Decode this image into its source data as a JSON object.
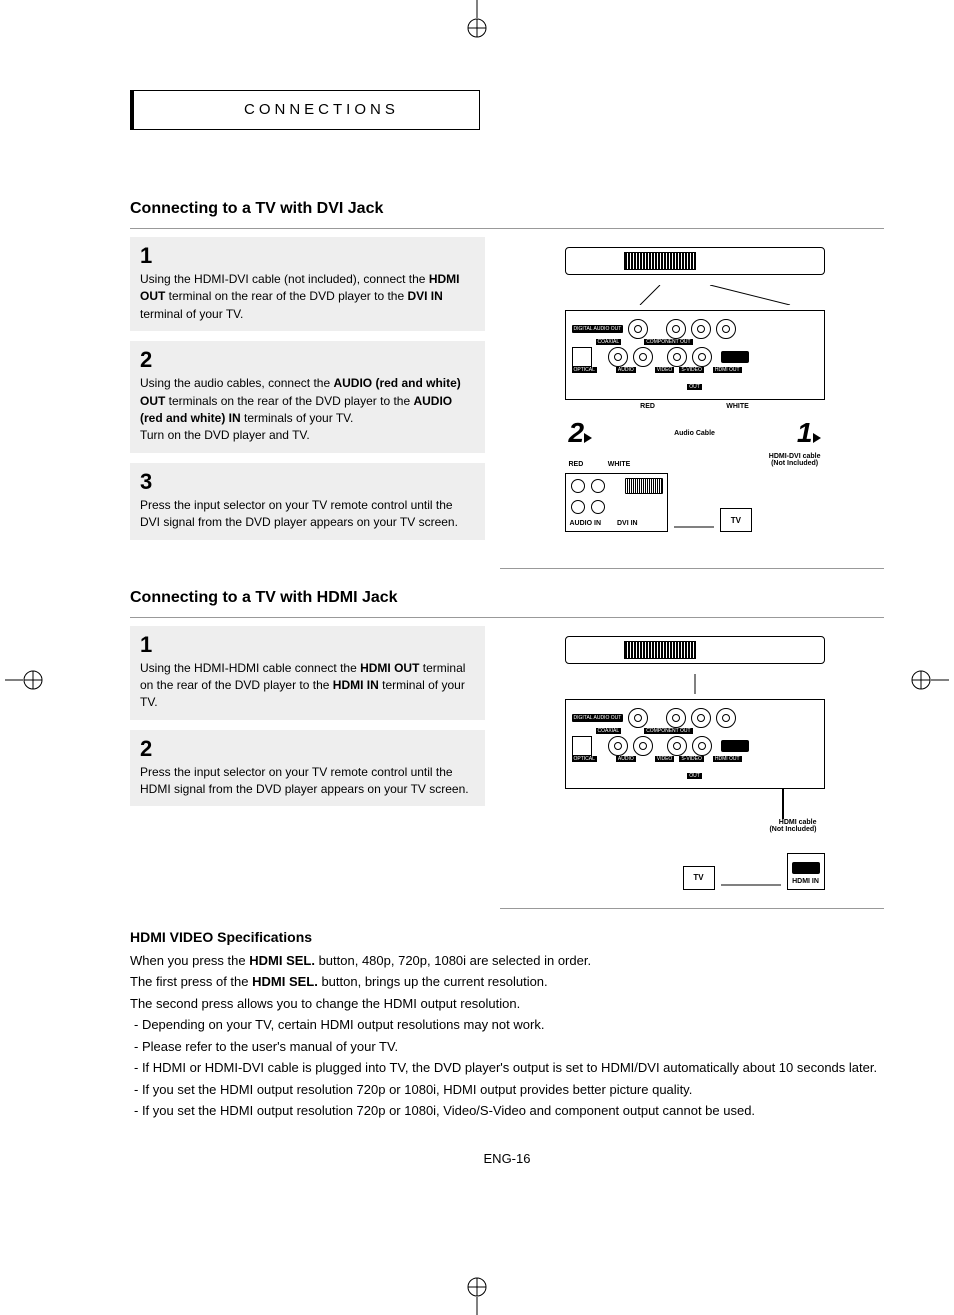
{
  "section_tab": "CONNECTIONS",
  "dvi": {
    "heading": "Connecting to a TV with DVI Jack",
    "steps": [
      {
        "num": "1",
        "parts": [
          {
            "t": "Using the HDMI-DVI cable (not included), connect the ",
            "b": false
          },
          {
            "t": "HDMI OUT",
            "b": true
          },
          {
            "t": " terminal on the rear of the DVD player to the ",
            "b": false
          },
          {
            "t": "DVI IN",
            "b": true
          },
          {
            "t": " terminal of your TV.",
            "b": false
          }
        ]
      },
      {
        "num": "2",
        "parts": [
          {
            "t": "Using the audio cables, connect the ",
            "b": false
          },
          {
            "t": "AUDIO (red and white) OUT",
            "b": true
          },
          {
            "t": " terminals on the rear of the DVD player to the ",
            "b": false
          },
          {
            "t": "AUDIO (red and white) IN",
            "b": true
          },
          {
            "t": " terminals of your TV.",
            "b": false
          }
        ],
        "extra": "Turn on the DVD player and TV."
      },
      {
        "num": "3",
        "parts": [
          {
            "t": "Press the input selector on your TV remote control until the DVI signal from the DVD player appears on your TV screen.",
            "b": false
          }
        ]
      }
    ],
    "diagram": {
      "labels": {
        "digital_audio_out": "DIGITAL AUDIO OUT",
        "coaxial": "COAXIAL",
        "component_out": "COMPONENT OUT",
        "optical": "OPTICAL",
        "audio": "AUDIO",
        "video": "VIDEO",
        "svideo": "S-VIDEO",
        "out": "OUT",
        "hdmi_out": "HDMI OUT",
        "red": "RED",
        "white": "WHITE",
        "audio_cable": "Audio Cable",
        "cable": "HDMI-DVI cable",
        "cable_note": "(Not Included)",
        "audio_in": "AUDIO IN",
        "dvi_in": "DVI IN",
        "tv": "TV",
        "num1": "1",
        "num2": "2"
      }
    }
  },
  "hdmi": {
    "heading": "Connecting to a TV with HDMI Jack",
    "steps": [
      {
        "num": "1",
        "parts": [
          {
            "t": "Using the HDMI-HDMI cable connect the ",
            "b": false
          },
          {
            "t": "HDMI OUT",
            "b": true
          },
          {
            "t": " terminal on the rear of the DVD player to the ",
            "b": false
          },
          {
            "t": "HDMI IN",
            "b": true
          },
          {
            "t": " terminal of your TV.",
            "b": false
          }
        ]
      },
      {
        "num": "2",
        "parts": [
          {
            "t": "Press the input selector on your TV remote control until the HDMI signal from the DVD player appears on your TV screen.",
            "b": false
          }
        ]
      }
    ],
    "diagram": {
      "labels": {
        "digital_audio_out": "DIGITAL AUDIO OUT",
        "coaxial": "COAXIAL",
        "component_out": "COMPONENT OUT",
        "optical": "OPTICAL",
        "audio": "AUDIO",
        "video": "VIDEO",
        "svideo": "S-VIDEO",
        "out": "OUT",
        "hdmi_out": "HDMI OUT",
        "cable": "HDMI cable",
        "cable_note": "(Not Included)",
        "hdmi_in": "HDMI IN",
        "tv": "TV"
      }
    }
  },
  "specs": {
    "heading": "HDMI VIDEO Specifications",
    "intro": [
      [
        {
          "t": "When you press the ",
          "b": false
        },
        {
          "t": "HDMI SEL.",
          "b": true
        },
        {
          "t": " button, 480p, 720p, 1080i are selected in order.",
          "b": false
        }
      ],
      [
        {
          "t": "The first press of the ",
          "b": false
        },
        {
          "t": "HDMI SEL.",
          "b": true
        },
        {
          "t": " button, brings up the current resolution.",
          "b": false
        }
      ],
      [
        {
          "t": "The second press allows you to change the HDMI output resolution.",
          "b": false
        }
      ]
    ],
    "bullets": [
      "- Depending on your TV, certain HDMI output resolutions may not work.",
      "- Please refer to the user's manual of your TV.",
      "- If HDMI or HDMI-DVI cable is plugged into TV, the DVD player's output is set to HDMI/DVI automatically about 10 seconds later.",
      "- If you set the HDMI output resolution 720p or 1080i, HDMI output provides better picture quality.",
      "- If you set the HDMI output resolution 720p or 1080i, Video/S-Video and component output cannot be used."
    ]
  },
  "page_number": "ENG-16"
}
